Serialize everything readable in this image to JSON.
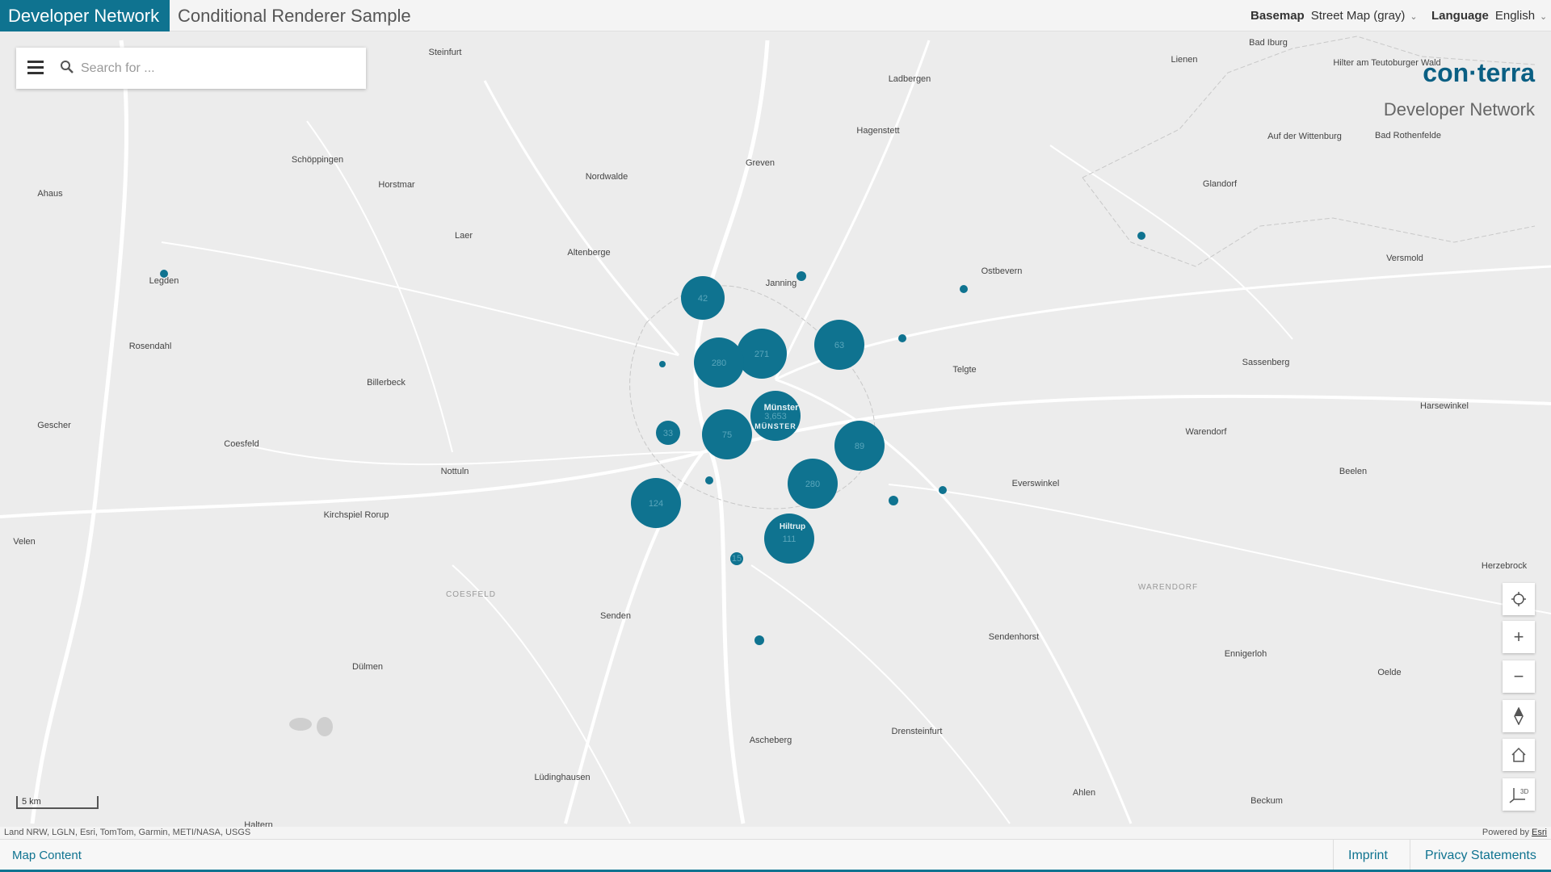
{
  "header": {
    "brand": "Developer Network",
    "title": "Conditional Renderer Sample",
    "basemap_label": "Basemap",
    "basemap_value": "Street Map (gray)",
    "language_label": "Language",
    "language_value": "English"
  },
  "search": {
    "placeholder": "Search for ..."
  },
  "logo": {
    "name": "con·terra",
    "subtitle": "Developer Network"
  },
  "map": {
    "places": [
      {
        "name": "Steinfurt"
      },
      {
        "name": "Bad Iburg"
      },
      {
        "name": "Lienen"
      },
      {
        "name": "Ladbergen"
      },
      {
        "name": "Hilter am Teutoburger Wald"
      },
      {
        "name": "Hagenstett"
      },
      {
        "name": "Auf der Wittenburg"
      },
      {
        "name": "Bad Rothenfelde"
      },
      {
        "name": "Schöppingen"
      },
      {
        "name": "Horstmar"
      },
      {
        "name": "Nordwalde"
      },
      {
        "name": "Greven"
      },
      {
        "name": "Glandorf"
      },
      {
        "name": "Ahaus"
      },
      {
        "name": "Laer"
      },
      {
        "name": "Altenberge"
      },
      {
        "name": "Legden"
      },
      {
        "name": "Janning"
      },
      {
        "name": "Ostbevern"
      },
      {
        "name": "Versmold"
      },
      {
        "name": "Rosendahl"
      },
      {
        "name": "Billerbeck"
      },
      {
        "name": "Telgte"
      },
      {
        "name": "Sassenberg"
      },
      {
        "name": "Gescher"
      },
      {
        "name": "Coesfeld"
      },
      {
        "name": "Warendorf"
      },
      {
        "name": "Harsewinkel"
      },
      {
        "name": "Nottuln"
      },
      {
        "name": "Everswinkel"
      },
      {
        "name": "Beelen"
      },
      {
        "name": "Kirchspiel Rorup"
      },
      {
        "name": "Velen"
      },
      {
        "name": "Herzebrock"
      },
      {
        "name": "Senden"
      },
      {
        "name": "Sendenhorst"
      },
      {
        "name": "Ennigerloh"
      },
      {
        "name": "Dülmen"
      },
      {
        "name": "Oelde"
      },
      {
        "name": "Ascheberg"
      },
      {
        "name": "Drensteinfurt"
      },
      {
        "name": "Lüdinghausen"
      },
      {
        "name": "Ahlen"
      },
      {
        "name": "Beckum"
      },
      {
        "name": "Haltern"
      },
      {
        "name": "Münster"
      },
      {
        "name": "Hiltrup"
      }
    ],
    "regions": [
      "COESFELD",
      "WARENDORF",
      "MÜNSTER"
    ],
    "clusters": [
      {
        "count": "42"
      },
      {
        "count": "271"
      },
      {
        "count": "280"
      },
      {
        "count": "63"
      },
      {
        "count": "3,653"
      },
      {
        "count": "33"
      },
      {
        "count": "75"
      },
      {
        "count": "89"
      },
      {
        "count": "280"
      },
      {
        "count": "124"
      },
      {
        "count": "111"
      },
      {
        "count": "15"
      }
    ],
    "cluster_color": "#0f7390"
  },
  "scale": {
    "label": "5 km"
  },
  "attribution": {
    "sources": "Land NRW, LGLN, Esri, TomTom, Garmin, METI/NASA, USGS",
    "powered_by": "Powered by",
    "powered_link": "Esri"
  },
  "footer": {
    "map_content": "Map Content",
    "imprint": "Imprint",
    "privacy": "Privacy Statements"
  },
  "tools": [
    {
      "icon": "locate-icon"
    },
    {
      "icon": "zoom-in-icon"
    },
    {
      "icon": "zoom-out-icon"
    },
    {
      "icon": "compass-icon"
    },
    {
      "icon": "home-icon"
    },
    {
      "icon": "3d-toggle-icon"
    }
  ],
  "colors": {
    "accent": "#0f7390",
    "map_background": "#ececec"
  }
}
